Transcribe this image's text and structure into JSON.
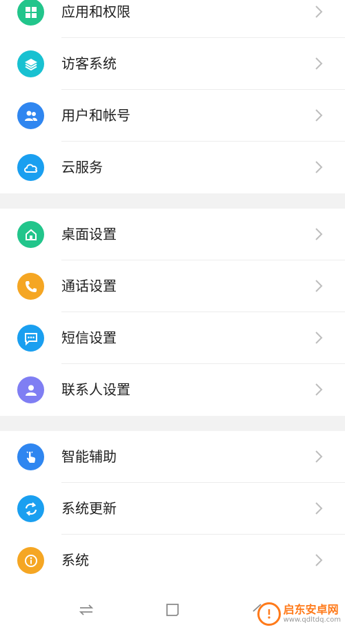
{
  "settings": {
    "group1": [
      {
        "label": "应用和权限",
        "color": "#22c58b",
        "icon": "grid-icon"
      },
      {
        "label": "访客系统",
        "color": "#18c1d1",
        "icon": "layers-icon"
      },
      {
        "label": "用户和帐号",
        "color": "#2f86f0",
        "icon": "users-icon"
      },
      {
        "label": "云服务",
        "color": "#1a9ff0",
        "icon": "cloud-icon"
      }
    ],
    "group2": [
      {
        "label": "桌面设置",
        "color": "#22c58b",
        "icon": "home-icon"
      },
      {
        "label": "通话设置",
        "color": "#f5a623",
        "icon": "phone-icon"
      },
      {
        "label": "短信设置",
        "color": "#1a9ff0",
        "icon": "message-icon"
      },
      {
        "label": "联系人设置",
        "color": "#7f7ef3",
        "icon": "contact-icon"
      }
    ],
    "group3": [
      {
        "label": "智能辅助",
        "color": "#2f86f0",
        "icon": "gesture-icon"
      },
      {
        "label": "系统更新",
        "color": "#1a9ff0",
        "icon": "refresh-icon"
      },
      {
        "label": "系统",
        "color": "#f5a623",
        "icon": "info-icon"
      }
    ]
  },
  "watermark": {
    "title": "启东安卓网",
    "url": "www.qdltdq.com"
  }
}
